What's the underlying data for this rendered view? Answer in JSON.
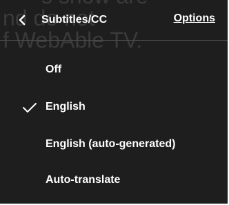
{
  "background_caption": {
    "lines": [
      "s show are",
      "nd do not",
      "f WebAble TV."
    ]
  },
  "header": {
    "title": "Subtitles/CC",
    "options_label": "Options",
    "back_icon": "chevron-left-icon"
  },
  "items": [
    {
      "label": "Off",
      "selected": false
    },
    {
      "label": "English",
      "selected": true
    },
    {
      "label": "English (auto-generated)",
      "selected": false
    },
    {
      "label": "Auto-translate",
      "selected": false
    }
  ],
  "colors": {
    "menu_background": "#1e1e1e",
    "text": "#ffffff",
    "caption_text": "#3a3a3a",
    "divider": "#4a4a4a"
  },
  "icons": {
    "selected_marker": "checkmark-icon"
  }
}
